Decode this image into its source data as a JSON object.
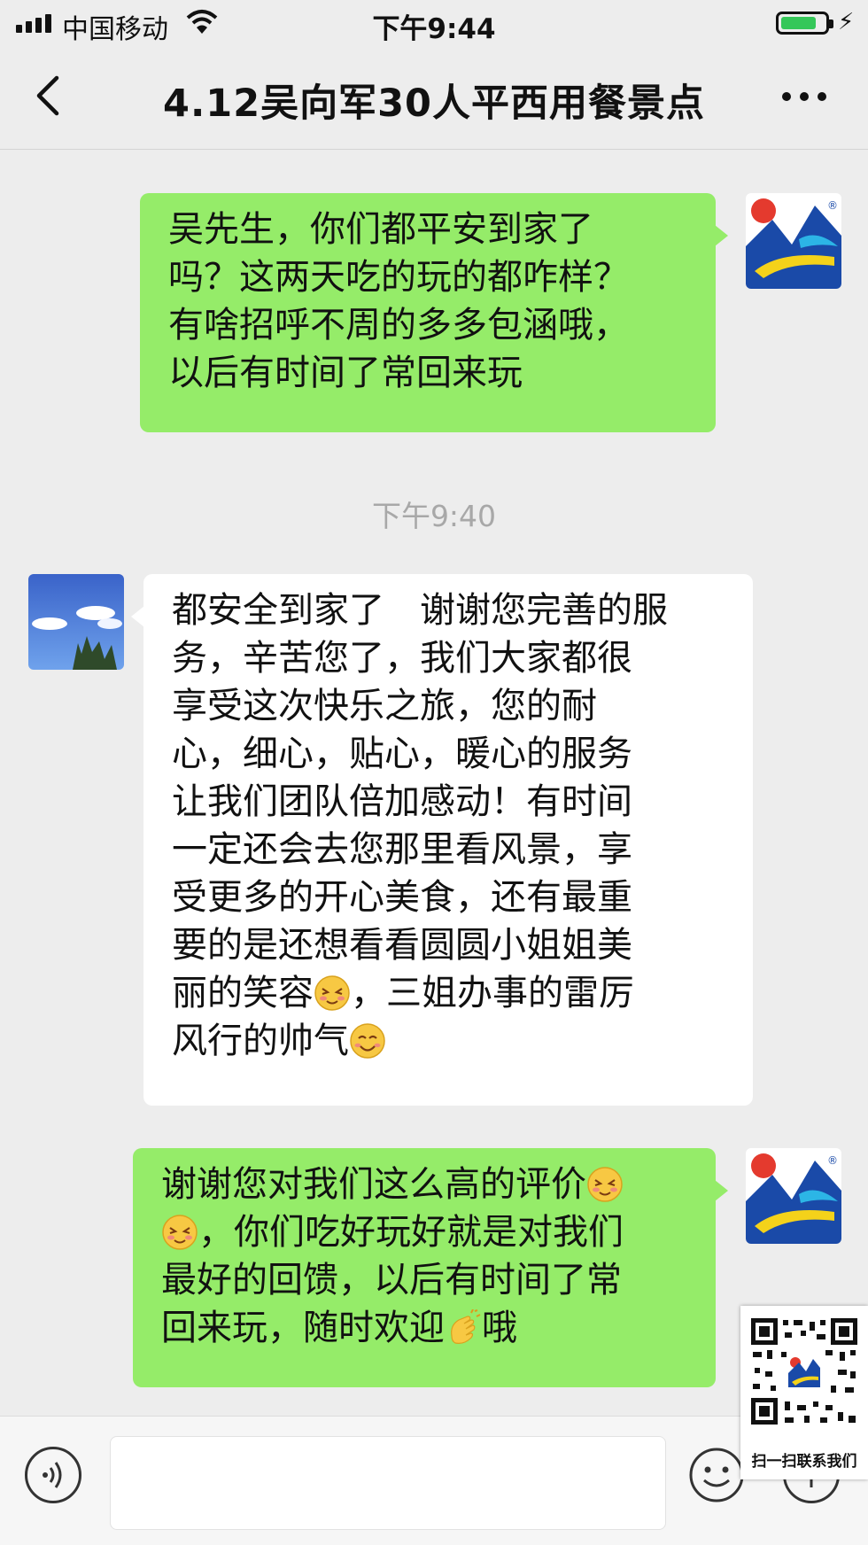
{
  "status_bar": {
    "carrier": "中国移动",
    "time": "下午9:44"
  },
  "header": {
    "back_icon": "chevron-left-icon",
    "title": "4.12吴向军30人平西用餐景点",
    "more_icon": "ellipsis-icon"
  },
  "messages": [
    {
      "side": "right",
      "text": "吴先生，你们都平安到家了\n吗？这两天吃的玩的都咋样？\n有啥招呼不周的多多包涵哦，\n以后有时间了常回来玩"
    },
    {
      "side": "left",
      "text": "都安全到家了　谢谢您完善的服\n务，辛苦您了，我们大家都很\n享受这次快乐之旅，您的耐\n心，细心，贴心，暖心的服务\n让我们团队倍加感动！有时间\n一定还会去您那里看风景，享\n受更多的开心美食，还有最重\n要的是还想看看圆圆小姐姐美\n丽的笑容",
      "text_b": "，三姐办事的雷厉\n风行的帅气"
    },
    {
      "side": "right",
      "text": "谢谢您对我们这么高的评价",
      "text_b": "，你们吃好玩好就是对我们\n最好的回馈，以后有时间了常\n回来玩，随时欢迎",
      "text_c": "哦"
    }
  ],
  "timestamp": "下午9:40",
  "input_bar": {
    "voice_icon": "voice-icon",
    "emoji_icon": "emoji-icon",
    "plus_icon": "plus-icon"
  },
  "qr_overlay": {
    "caption": "扫一扫联系我们"
  },
  "colors": {
    "sent_bubble": "#95ec69",
    "received_bubble": "#ffffff",
    "background": "#ededed"
  }
}
